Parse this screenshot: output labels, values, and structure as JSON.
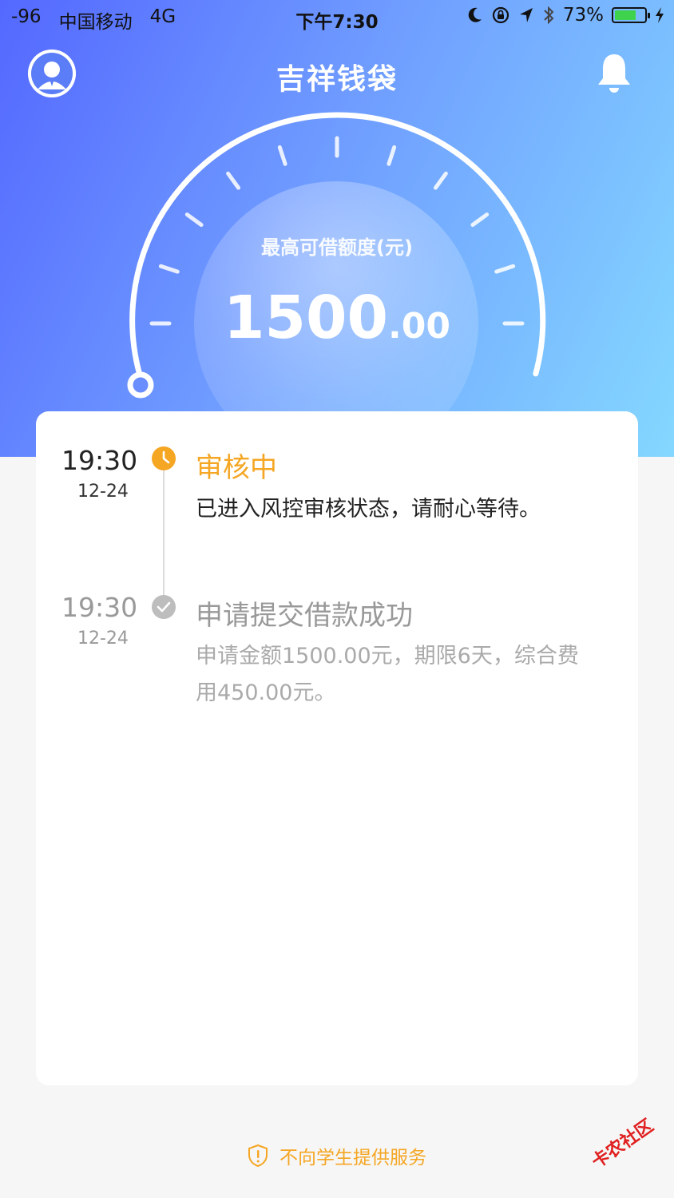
{
  "status_bar": {
    "signal": "-96",
    "carrier": "中国移动",
    "network": "4G",
    "time": "下午7:30",
    "battery_text": "73%",
    "battery_level": 0.73
  },
  "header": {
    "title": "吉祥钱袋",
    "avatar_icon": "user-avatar-icon",
    "bell_icon": "bell-icon"
  },
  "credit": {
    "label": "最高可借额度(元)",
    "amount_int": "1500",
    "amount_dec": ".00"
  },
  "timeline": [
    {
      "time": "19:30",
      "date": "12-24",
      "title": "审核中",
      "desc": "已进入风控审核状态，请耐心等待。",
      "icon": "clock-icon",
      "color": "#f5a623"
    },
    {
      "time": "19:30",
      "date": "12-24",
      "title": "申请提交借款成功",
      "desc": "申请金额1500.00元，期限6天，综合费用450.00元。",
      "icon": "check-icon",
      "color": "#bdbdbd"
    }
  ],
  "footer": {
    "note": "不向学生提供服务",
    "icon": "shield-alert-icon"
  },
  "watermark": {
    "text": "卡农社区"
  },
  "colors": {
    "accent": "#f5a623",
    "gradient_start": "#5468ff",
    "gradient_end": "#84d8ff"
  }
}
